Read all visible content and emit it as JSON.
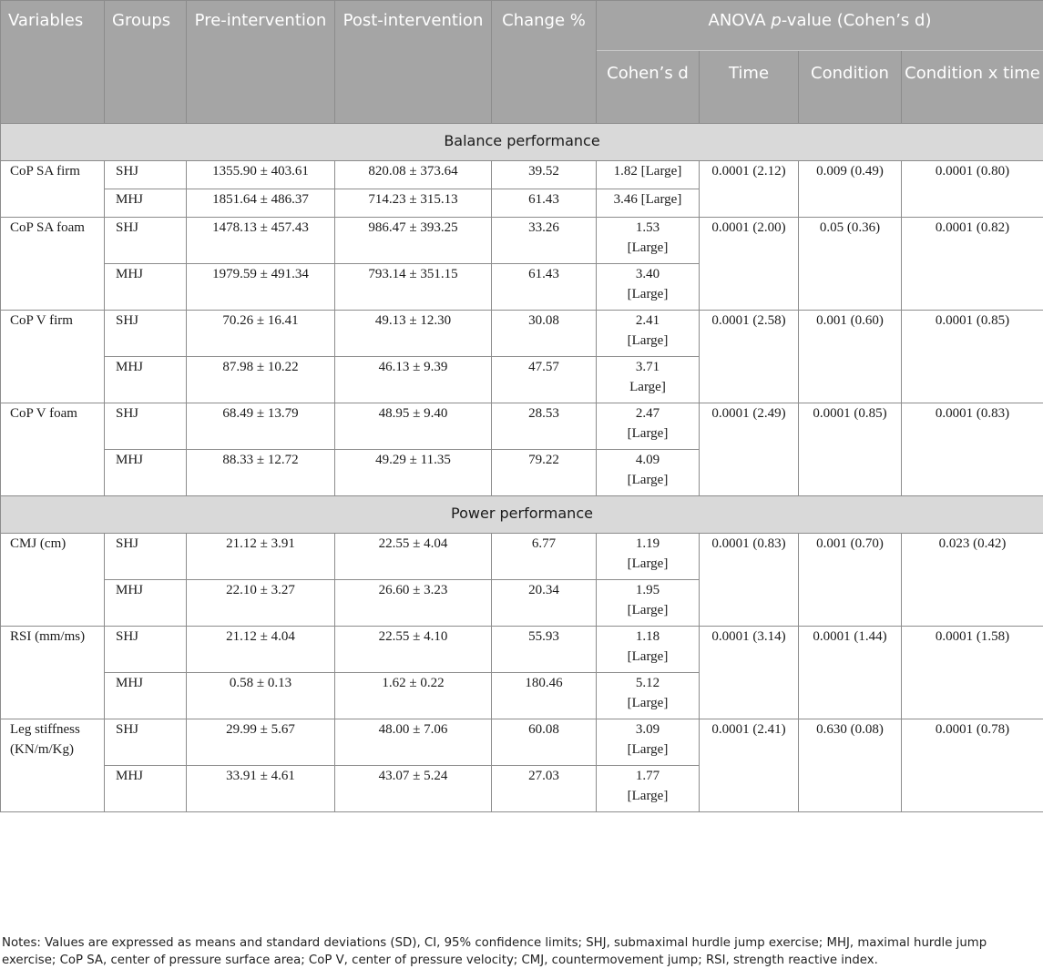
{
  "headers": {
    "variables": "Variables",
    "groups": "Groups",
    "pre": "Pre-intervention",
    "post": "Post-intervention",
    "change": "Change %",
    "anova_prefix": "ANOVA ",
    "anova_p": "p",
    "anova_suffix": "-value (Cohen’s d)",
    "cohens_d": "Cohen’s d",
    "time": "Time",
    "condition": "Condition",
    "condition_x_time": "Condition x time"
  },
  "sections": [
    {
      "title": "Balance performance",
      "variables": [
        {
          "name": "CoP SA firm",
          "time": "0.0001 (2.12)",
          "condition": "0.009 (0.49)",
          "interaction": "0.0001 (0.80)",
          "rows": [
            {
              "group": "SHJ",
              "pre": "1355.90 ± 403.61",
              "post": "820.08 ± 373.64",
              "change": "39.52",
              "d": "1.82 [Large]"
            },
            {
              "group": "MHJ",
              "pre": "1851.64 ± 486.37",
              "post": "714.23 ± 315.13",
              "change": "61.43",
              "d": "3.46 [Large]"
            }
          ]
        },
        {
          "name": "CoP SA foam",
          "time": "0.0001 (2.00)",
          "condition": "0.05 (0.36)",
          "interaction": "0.0001 (0.82)",
          "rows": [
            {
              "group": "SHJ",
              "pre": "1478.13 ± 457.43",
              "post": "986.47 ± 393.25",
              "change": "33.26",
              "d": "1.53 [Large]"
            },
            {
              "group": "MHJ",
              "pre": "1979.59 ± 491.34",
              "post": "793.14 ± 351.15",
              "change": "61.43",
              "d": "3.40 [Large]"
            }
          ]
        },
        {
          "name": "CoP V firm",
          "time": "0.0001 (2.58)",
          "condition": "0.001 (0.60)",
          "interaction": "0.0001 (0.85)",
          "rows": [
            {
              "group": "SHJ",
              "pre": "70.26 ± 16.41",
              "post": "49.13 ± 12.30",
              "change": "30.08",
              "d": "2.41 [Large]"
            },
            {
              "group": "MHJ",
              "pre": "87.98 ± 10.22",
              "post": "46.13 ± 9.39",
              "change": "47.57",
              "d": "3.71 Large]"
            }
          ]
        },
        {
          "name": "CoP V foam",
          "time": "0.0001 (2.49)",
          "condition": "0.0001 (0.85)",
          "interaction": "0.0001 (0.83)",
          "rows": [
            {
              "group": "SHJ",
              "pre": "68.49 ± 13.79",
              "post": "48.95 ± 9.40",
              "change": "28.53",
              "d": "2.47 [Large]"
            },
            {
              "group": "MHJ",
              "pre": "88.33 ± 12.72",
              "post": "49.29 ± 11.35",
              "change": "79.22",
              "d": "4.09 [Large]"
            }
          ]
        }
      ]
    },
    {
      "title": "Power performance",
      "variables": [
        {
          "name": "CMJ (cm)",
          "time": "0.0001 (0.83)",
          "condition": "0.001 (0.70)",
          "interaction": "0.023 (0.42)",
          "rows": [
            {
              "group": "SHJ",
              "pre": "21.12 ± 3.91",
              "post": "22.55 ± 4.04",
              "change": "6.77",
              "d": "1.19 [Large]"
            },
            {
              "group": "MHJ",
              "pre": "22.10 ± 3.27",
              "post": "26.60 ± 3.23",
              "change": "20.34",
              "d": "1.95 [Large]"
            }
          ]
        },
        {
          "name": "RSI (mm/ms)",
          "time": "0.0001 (3.14)",
          "condition": "0.0001 (1.44)",
          "interaction": "0.0001 (1.58)",
          "rows": [
            {
              "group": "SHJ",
              "pre": "21.12 ± 4.04",
              "post": "22.55 ± 4.10",
              "change": "55.93",
              "d": "1.18 [Large]"
            },
            {
              "group": "MHJ",
              "pre": "0.58 ± 0.13",
              "post": "1.62 ± 0.22",
              "change": "180.46",
              "d": "5.12 [Large]"
            }
          ]
        },
        {
          "name": "Leg stiffness (KN/m/Kg)",
          "time": "0.0001 (2.41)",
          "condition": "0.630 (0.08)",
          "interaction": "0.0001 (0.78)",
          "rows": [
            {
              "group": "SHJ",
              "pre": "29.99 ± 5.67",
              "post": "48.00 ± 7.06",
              "change": "60.08",
              "d": "3.09 [Large]"
            },
            {
              "group": "MHJ",
              "pre": "33.91 ± 4.61",
              "post": "43.07 ± 5.24",
              "change": "27.03",
              "d": "1.77 [Large]"
            }
          ]
        }
      ]
    }
  ],
  "notes": "Notes: Values are expressed as means and standard deviations (SD), CI, 95% confidence limits; SHJ, submaximal hurdle jump exercise; MHJ, maximal hurdle jump exercise; CoP SA, center of pressure surface area; CoP V, center of pressure velocity; CMJ, countermovement jump; RSI, strength reactive index."
}
